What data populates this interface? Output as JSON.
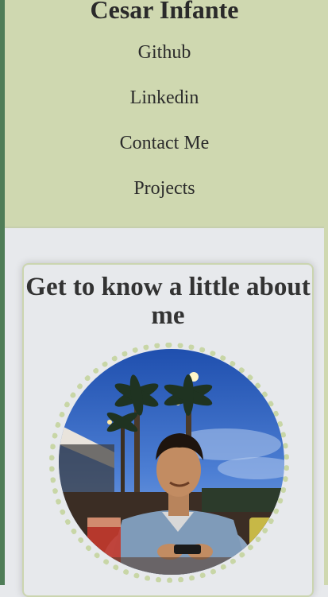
{
  "header": {
    "title": "Cesar Infante",
    "nav": [
      "Github",
      "Linkedin",
      "Contact Me",
      "Projects"
    ]
  },
  "about": {
    "heading": "Get to know a little about me",
    "photo_icon": "profile-photo"
  },
  "colors": {
    "header_bg": "#cfd8b0",
    "page_bg": "#e7e9ec",
    "left_rail": "#4f7d57",
    "ring": "#c8d6a6"
  }
}
